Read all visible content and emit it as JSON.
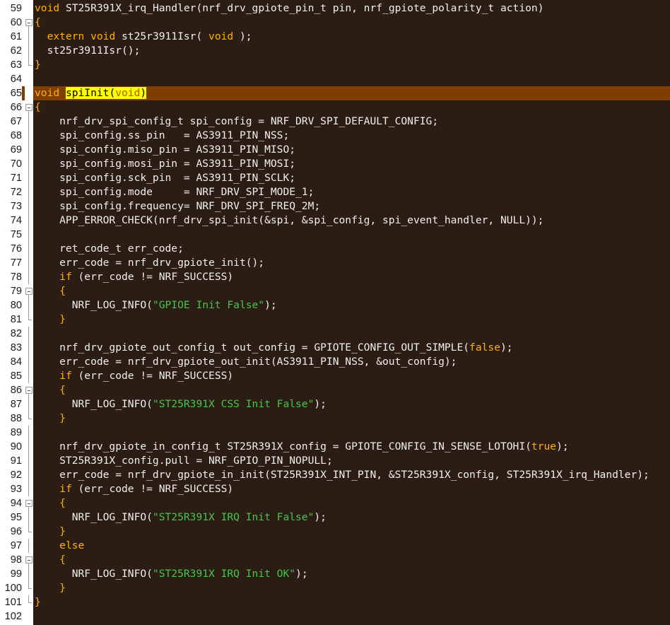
{
  "editor": {
    "lines": [
      {
        "n": "59",
        "fold": "none",
        "segs": [
          {
            "t": "void",
            "c": "kw"
          },
          {
            "t": " ST25R391X_irq_Handler(nrf_drv_gpiote_pin_t pin, nrf_gpiote_polarity_t action)",
            "c": ""
          }
        ]
      },
      {
        "n": "60",
        "fold": "open",
        "segs": [
          {
            "t": "{",
            "c": "brace"
          }
        ]
      },
      {
        "n": "61",
        "fold": "line",
        "segs": [
          {
            "t": "  ",
            "c": ""
          },
          {
            "t": "extern void",
            "c": "kw"
          },
          {
            "t": " st25r3911Isr( ",
            "c": ""
          },
          {
            "t": "void",
            "c": "kw"
          },
          {
            "t": " );",
            "c": ""
          }
        ]
      },
      {
        "n": "62",
        "fold": "line",
        "segs": [
          {
            "t": "  st25r3911Isr();",
            "c": ""
          }
        ]
      },
      {
        "n": "63",
        "fold": "end",
        "segs": [
          {
            "t": "}",
            "c": "brace"
          }
        ]
      },
      {
        "n": "64",
        "fold": "none",
        "segs": []
      },
      {
        "n": "65",
        "fold": "none",
        "current": true,
        "segs": [
          {
            "t": "void",
            "c": "kw"
          },
          {
            "t": " ",
            "c": ""
          },
          {
            "t": "spiInit",
            "c": "hl"
          },
          {
            "t": "(",
            "c": "hl"
          },
          {
            "t": "void",
            "c": "hl2"
          },
          {
            "t": ")",
            "c": "hl"
          }
        ]
      },
      {
        "n": "66",
        "fold": "open",
        "segs": [
          {
            "t": "{",
            "c": "brace"
          }
        ]
      },
      {
        "n": "67",
        "fold": "line",
        "segs": [
          {
            "t": "    nrf_drv_spi_config_t spi_config = NRF_DRV_SPI_DEFAULT_CONFIG;",
            "c": ""
          }
        ]
      },
      {
        "n": "68",
        "fold": "line",
        "segs": [
          {
            "t": "    spi_config.ss_pin   = AS3911_PIN_NSS;",
            "c": ""
          }
        ]
      },
      {
        "n": "69",
        "fold": "line",
        "segs": [
          {
            "t": "    spi_config.miso_pin = AS3911_PIN_MISO;",
            "c": ""
          }
        ]
      },
      {
        "n": "70",
        "fold": "line",
        "segs": [
          {
            "t": "    spi_config.mosi_pin = AS3911_PIN_MOSI;",
            "c": ""
          }
        ]
      },
      {
        "n": "71",
        "fold": "line",
        "segs": [
          {
            "t": "    spi_config.sck_pin  = AS3911_PIN_SCLK;",
            "c": ""
          }
        ]
      },
      {
        "n": "72",
        "fold": "line",
        "segs": [
          {
            "t": "    spi_config.mode     = NRF_DRV_SPI_MODE_1;",
            "c": ""
          }
        ]
      },
      {
        "n": "73",
        "fold": "line",
        "segs": [
          {
            "t": "    spi_config.frequency= NRF_DRV_SPI_FREQ_2M;",
            "c": ""
          }
        ]
      },
      {
        "n": "74",
        "fold": "line",
        "segs": [
          {
            "t": "    APP_ERROR_CHECK(nrf_drv_spi_init(&spi, &spi_config, spi_event_handler, NULL));",
            "c": ""
          }
        ]
      },
      {
        "n": "75",
        "fold": "line",
        "segs": []
      },
      {
        "n": "76",
        "fold": "line",
        "segs": [
          {
            "t": "    ret_code_t err_code;",
            "c": ""
          }
        ]
      },
      {
        "n": "77",
        "fold": "line",
        "segs": [
          {
            "t": "    err_code = nrf_drv_gpiote_init();",
            "c": ""
          }
        ]
      },
      {
        "n": "78",
        "fold": "line",
        "segs": [
          {
            "t": "    ",
            "c": ""
          },
          {
            "t": "if",
            "c": "kw"
          },
          {
            "t": " (err_code != NRF_SUCCESS)",
            "c": ""
          }
        ]
      },
      {
        "n": "79",
        "fold": "open",
        "segs": [
          {
            "t": "    ",
            "c": ""
          },
          {
            "t": "{",
            "c": "brace"
          }
        ]
      },
      {
        "n": "80",
        "fold": "line",
        "segs": [
          {
            "t": "      NRF_LOG_INFO(",
            "c": ""
          },
          {
            "t": "\"GPIOE Init False\"",
            "c": "str"
          },
          {
            "t": ");",
            "c": ""
          }
        ]
      },
      {
        "n": "81",
        "fold": "end",
        "segs": [
          {
            "t": "    ",
            "c": ""
          },
          {
            "t": "}",
            "c": "brace"
          }
        ]
      },
      {
        "n": "82",
        "fold": "line",
        "segs": []
      },
      {
        "n": "83",
        "fold": "line",
        "segs": [
          {
            "t": "    nrf_drv_gpiote_out_config_t out_config = GPIOTE_CONFIG_OUT_SIMPLE(",
            "c": ""
          },
          {
            "t": "false",
            "c": "kw"
          },
          {
            "t": ");",
            "c": ""
          }
        ]
      },
      {
        "n": "84",
        "fold": "line",
        "segs": [
          {
            "t": "    err_code = nrf_drv_gpiote_out_init(AS3911_PIN_NSS, &out_config);",
            "c": ""
          }
        ]
      },
      {
        "n": "85",
        "fold": "line",
        "segs": [
          {
            "t": "    ",
            "c": ""
          },
          {
            "t": "if",
            "c": "kw"
          },
          {
            "t": " (err_code != NRF_SUCCESS)",
            "c": ""
          }
        ]
      },
      {
        "n": "86",
        "fold": "open",
        "segs": [
          {
            "t": "    ",
            "c": ""
          },
          {
            "t": "{",
            "c": "brace"
          }
        ]
      },
      {
        "n": "87",
        "fold": "line",
        "segs": [
          {
            "t": "      NRF_LOG_INFO(",
            "c": ""
          },
          {
            "t": "\"ST25R391X CSS Init False\"",
            "c": "str"
          },
          {
            "t": ");",
            "c": ""
          }
        ]
      },
      {
        "n": "88",
        "fold": "end",
        "segs": [
          {
            "t": "    ",
            "c": ""
          },
          {
            "t": "}",
            "c": "brace"
          }
        ]
      },
      {
        "n": "89",
        "fold": "line",
        "segs": []
      },
      {
        "n": "90",
        "fold": "line",
        "segs": [
          {
            "t": "    nrf_drv_gpiote_in_config_t ST25R391X_config = GPIOTE_CONFIG_IN_SENSE_LOTOHI(",
            "c": ""
          },
          {
            "t": "true",
            "c": "kw"
          },
          {
            "t": ");",
            "c": ""
          }
        ]
      },
      {
        "n": "91",
        "fold": "line",
        "segs": [
          {
            "t": "    ST25R391X_config.pull = NRF_GPIO_PIN_NOPULL;",
            "c": ""
          }
        ]
      },
      {
        "n": "92",
        "fold": "line",
        "segs": [
          {
            "t": "    err_code = nrf_drv_gpiote_in_init(ST25R391X_INT_PIN, &ST25R391X_config, ST25R391X_irq_Handler);",
            "c": ""
          }
        ]
      },
      {
        "n": "93",
        "fold": "line",
        "segs": [
          {
            "t": "    ",
            "c": ""
          },
          {
            "t": "if",
            "c": "kw"
          },
          {
            "t": " (err_code != NRF_SUCCESS)",
            "c": ""
          }
        ]
      },
      {
        "n": "94",
        "fold": "open",
        "segs": [
          {
            "t": "    ",
            "c": ""
          },
          {
            "t": "{",
            "c": "brace"
          }
        ]
      },
      {
        "n": "95",
        "fold": "line",
        "segs": [
          {
            "t": "      NRF_LOG_INFO(",
            "c": ""
          },
          {
            "t": "\"ST25R391X IRQ Init False\"",
            "c": "str"
          },
          {
            "t": ");",
            "c": ""
          }
        ]
      },
      {
        "n": "96",
        "fold": "end",
        "segs": [
          {
            "t": "    ",
            "c": ""
          },
          {
            "t": "}",
            "c": "brace"
          }
        ]
      },
      {
        "n": "97",
        "fold": "line",
        "segs": [
          {
            "t": "    ",
            "c": ""
          },
          {
            "t": "else",
            "c": "kw"
          }
        ]
      },
      {
        "n": "98",
        "fold": "open",
        "segs": [
          {
            "t": "    ",
            "c": ""
          },
          {
            "t": "{",
            "c": "brace"
          }
        ]
      },
      {
        "n": "99",
        "fold": "line",
        "segs": [
          {
            "t": "      NRF_LOG_INFO(",
            "c": ""
          },
          {
            "t": "\"ST25R391X IRQ Init OK\"",
            "c": "str"
          },
          {
            "t": ");",
            "c": ""
          }
        ]
      },
      {
        "n": "100",
        "fold": "end",
        "segs": [
          {
            "t": "    ",
            "c": ""
          },
          {
            "t": "}",
            "c": "brace"
          }
        ]
      },
      {
        "n": "101",
        "fold": "end",
        "segs": [
          {
            "t": "}",
            "c": "brace"
          }
        ]
      },
      {
        "n": "102",
        "fold": "none",
        "segs": []
      }
    ]
  },
  "colors": {
    "background": "#2b1d13",
    "gutter": "#ffffff",
    "current_line": "#7f3e00",
    "keyword": "#ffb000",
    "string": "#46c646",
    "text": "#f0f0f0",
    "match_highlight": "#ffff00"
  },
  "icons": {
    "fold_marker": "minus-box-icon"
  }
}
